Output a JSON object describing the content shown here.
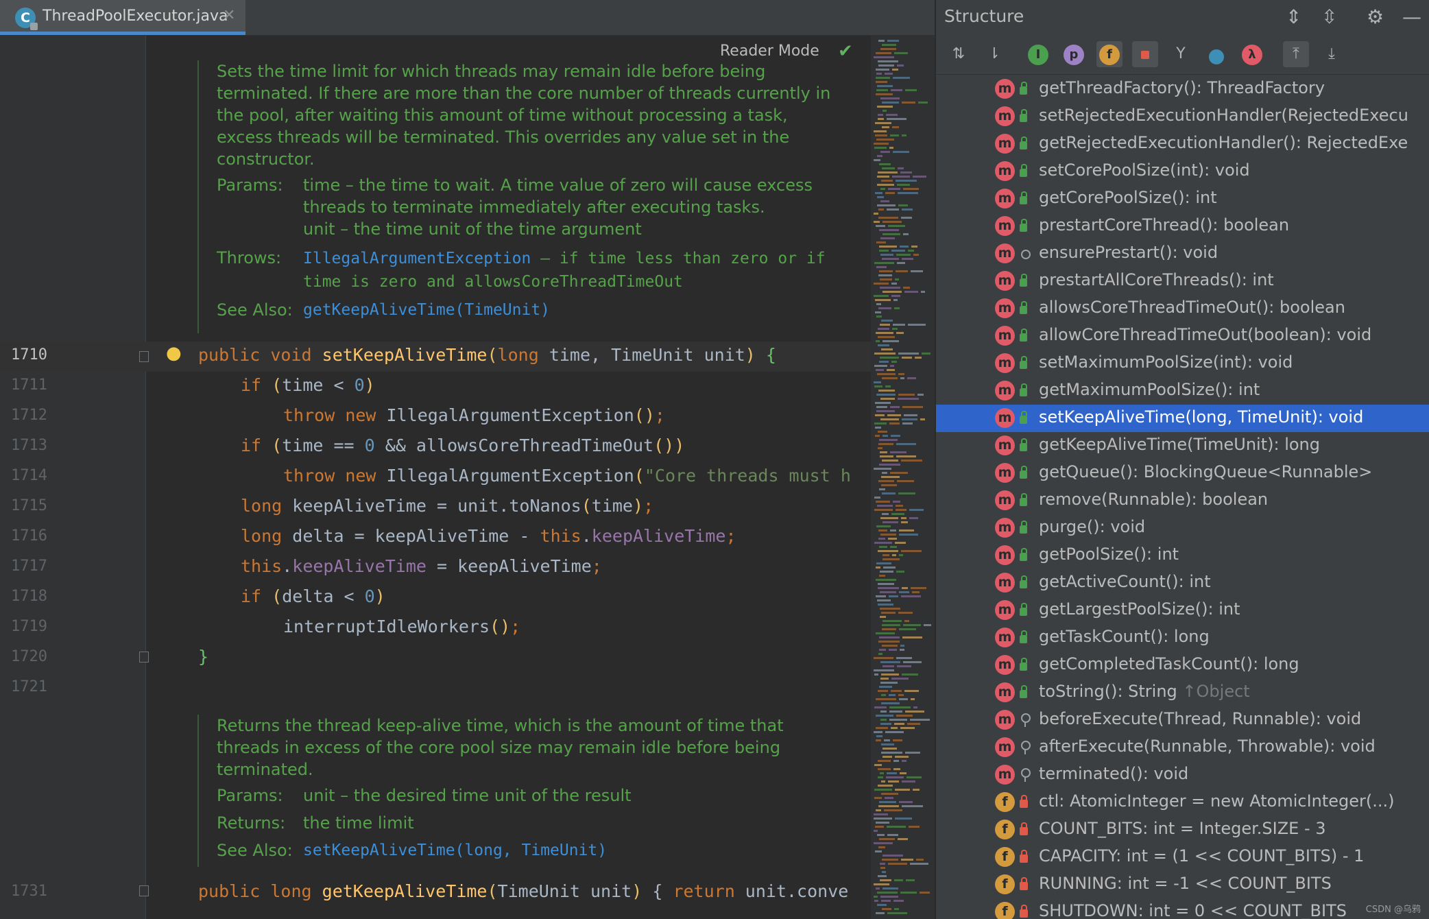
{
  "editor": {
    "tab": {
      "title": "ThreadPoolExecutor.java",
      "icon_letter": "C",
      "close": "✕"
    },
    "reader_mode": "Reader Mode",
    "line_numbers": [
      "1710",
      "1711",
      "1712",
      "1713",
      "1714",
      "1715",
      "1716",
      "1717",
      "1718",
      "1719",
      "1720",
      "1721",
      "1731"
    ],
    "doc1": {
      "description": "Sets the time limit for which threads may remain idle before being terminated. If there are more than the core number of threads currently in the pool, after waiting this amount of time without processing a task, excess threads will be terminated. This overrides any value set in the constructor.",
      "params_label": "Params:",
      "params_line1": "time – the time to wait. A time value of zero will cause excess threads to terminate immediately after executing tasks.",
      "params_line2": "unit – the time unit of the time argument",
      "throws_label": "Throws:",
      "throws_link": "IllegalArgumentException",
      "throws_text": " – if time less than zero or if time is zero and allowsCoreThreadTimeOut",
      "see_label": "See Also:",
      "see_link": "getKeepAliveTime(TimeUnit)"
    },
    "code": {
      "l1710": {
        "kw1": "public",
        "kw2": "void",
        "fn": "setKeepAliveTime",
        "p_open": "(",
        "kw3": "long",
        "rest": " time, TimeUnit unit",
        "p_close": ")",
        "brace": " {"
      },
      "l1711": {
        "kw": "if",
        "open": "(",
        "expr": "time < ",
        "num": "0",
        "close": ")"
      },
      "l1712": {
        "kw1": "throw",
        "kw2": "new",
        "call": "IllegalArgumentException",
        "args": "()",
        "semi": ";"
      },
      "l1713": {
        "kw": "if",
        "open": "(",
        "expr1": "time == ",
        "num": "0",
        "expr2": " && allowsCoreThreadTimeOut",
        "args": "()",
        "close": ")"
      },
      "l1714": {
        "kw1": "throw",
        "kw2": "new",
        "call": "IllegalArgumentException",
        "open": "(",
        "str": "\"Core threads must h"
      },
      "l1715": {
        "kw": "long",
        "text": " keepAliveTime = unit.toNanos",
        "open": "(",
        "arg": "time",
        "close": ")",
        "semi": ";"
      },
      "l1716": {
        "kw": "long",
        "text": " delta = keepAliveTime - ",
        "this": "this",
        "dot": ".",
        "field": "keepAliveTime",
        "semi": ";"
      },
      "l1717": {
        "this": "this",
        "dot": ".",
        "field": "keepAliveTime",
        "text": " = keepAliveTime",
        "semi": ";"
      },
      "l1718": {
        "kw": "if",
        "open": "(",
        "expr": "delta < ",
        "num": "0",
        "close": ")"
      },
      "l1719": {
        "call": "interruptIdleWorkers",
        "args": "()",
        "semi": ";"
      },
      "l1720": {
        "brace": "}"
      },
      "l1731": {
        "kw1": "public",
        "kw2": "long",
        "fn": "getKeepAliveTime",
        "open": "(",
        "params": "TimeUnit unit",
        "close": ")",
        "body": " { ",
        "kw3": "return",
        "rest": " unit.conve"
      }
    },
    "doc2": {
      "description": "Returns the thread keep-alive time, which is the amount of time that threads in excess of the core pool size may remain idle before being terminated.",
      "params_label": "Params:",
      "params_text": "unit – the desired time unit of the result",
      "returns_label": "Returns:",
      "returns_text": "the time limit",
      "see_label": "See Also:",
      "see_link": "setKeepAliveTime(long, TimeUnit)"
    }
  },
  "structure": {
    "title": "Structure",
    "items": [
      {
        "badge": "m",
        "vis": "public",
        "text": "getThreadFactory(): ThreadFactory"
      },
      {
        "badge": "m",
        "vis": "public",
        "text": "setRejectedExecutionHandler(RejectedExecu"
      },
      {
        "badge": "m",
        "vis": "public",
        "text": "getRejectedExecutionHandler(): RejectedExe"
      },
      {
        "badge": "m",
        "vis": "public",
        "text": "setCorePoolSize(int): void"
      },
      {
        "badge": "m",
        "vis": "public",
        "text": "getCorePoolSize(): int"
      },
      {
        "badge": "m",
        "vis": "public",
        "text": "prestartCoreThread(): boolean"
      },
      {
        "badge": "m",
        "vis": "package",
        "text": "ensurePrestart(): void"
      },
      {
        "badge": "m",
        "vis": "public",
        "text": "prestartAllCoreThreads(): int"
      },
      {
        "badge": "m",
        "vis": "public",
        "text": "allowsCoreThreadTimeOut(): boolean"
      },
      {
        "badge": "m",
        "vis": "public",
        "text": "allowCoreThreadTimeOut(boolean): void"
      },
      {
        "badge": "m",
        "vis": "public",
        "text": "setMaximumPoolSize(int): void"
      },
      {
        "badge": "m",
        "vis": "public",
        "text": "getMaximumPoolSize(): int"
      },
      {
        "badge": "m",
        "vis": "public",
        "text": "setKeepAliveTime(long, TimeUnit): void",
        "selected": true
      },
      {
        "badge": "m",
        "vis": "public",
        "text": "getKeepAliveTime(TimeUnit): long"
      },
      {
        "badge": "m",
        "vis": "public",
        "text": "getQueue(): BlockingQueue<Runnable>"
      },
      {
        "badge": "m",
        "vis": "public",
        "text": "remove(Runnable): boolean"
      },
      {
        "badge": "m",
        "vis": "public",
        "text": "purge(): void"
      },
      {
        "badge": "m",
        "vis": "public",
        "text": "getPoolSize(): int"
      },
      {
        "badge": "m",
        "vis": "public",
        "text": "getActiveCount(): int"
      },
      {
        "badge": "m",
        "vis": "public",
        "text": "getLargestPoolSize(): int"
      },
      {
        "badge": "m",
        "vis": "public",
        "text": "getTaskCount(): long"
      },
      {
        "badge": "m",
        "vis": "public",
        "text": "getCompletedTaskCount(): long"
      },
      {
        "badge": "m",
        "vis": "public",
        "text": "toString(): String",
        "suffix": " ↑Object"
      },
      {
        "badge": "m",
        "vis": "protected",
        "text": "beforeExecute(Thread, Runnable): void"
      },
      {
        "badge": "m",
        "vis": "protected",
        "text": "afterExecute(Runnable, Throwable): void"
      },
      {
        "badge": "m",
        "vis": "protected",
        "text": "terminated(): void"
      },
      {
        "badge": "f",
        "vis": "private",
        "text": "ctl: AtomicInteger = new AtomicInteger(...)"
      },
      {
        "badge": "f",
        "vis": "private",
        "text": "COUNT_BITS: int = Integer.SIZE - 3"
      },
      {
        "badge": "f",
        "vis": "private",
        "text": "CAPACITY: int = (1 << COUNT_BITS) - 1"
      },
      {
        "badge": "f",
        "vis": "private",
        "text": "RUNNING: int = -1 << COUNT_BITS"
      },
      {
        "badge": "f",
        "vis": "private",
        "text": "SHUTDOWN: int = 0 << COUNT_BITS"
      }
    ]
  },
  "watermark": "CSDN @乌鸦",
  "colors": {
    "accent": "#2f65ca",
    "doc_green": "#56a24a",
    "keyword": "#cc7832",
    "method": "#ffc66d",
    "field": "#9876aa"
  }
}
